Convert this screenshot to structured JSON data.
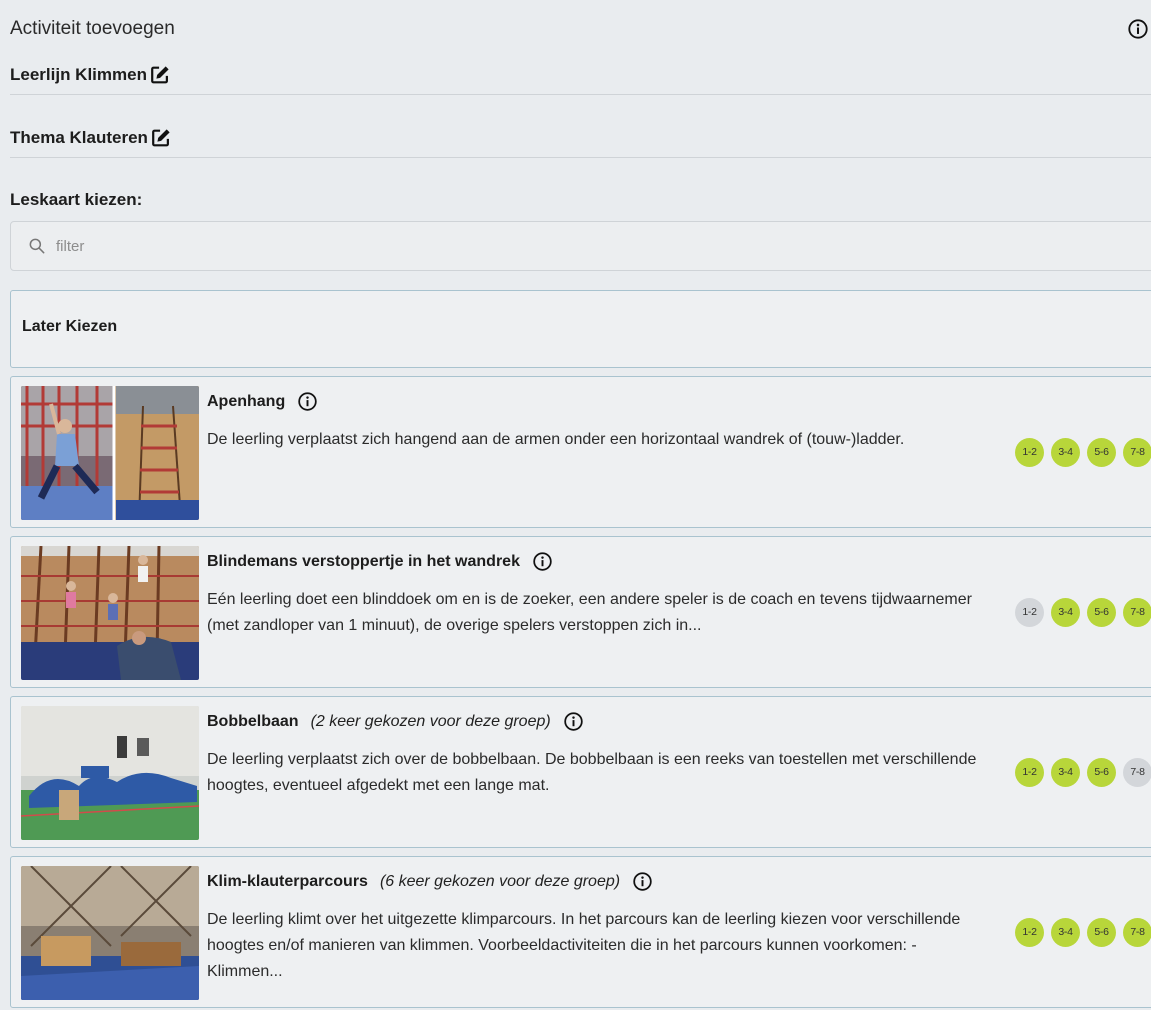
{
  "header": {
    "title": "Activiteit toevoegen"
  },
  "fields": {
    "leerlijn": "Leerlijn Klimmen",
    "thema": "Thema Klauteren"
  },
  "leskaart": {
    "label": "Leskaart kiezen:",
    "filter_placeholder": "filter",
    "later_option": "Later Kiezen"
  },
  "colors": {
    "badge_active": "#b8d63a",
    "badge_inactive": "#d3d6da",
    "card_border": "#a9c3cf"
  },
  "activities": [
    {
      "name": "Apenhang",
      "note": "",
      "description": "De leerling verplaatst zich hangend aan de armen onder een horizontaal wandrek of (touw-)ladder.",
      "groups": [
        {
          "label": "1-2",
          "active": true
        },
        {
          "label": "3-4",
          "active": true
        },
        {
          "label": "5-6",
          "active": true
        },
        {
          "label": "7-8",
          "active": true
        }
      ]
    },
    {
      "name": "Blindemans verstoppertje in het wandrek",
      "note": "",
      "description": "Eén leerling doet een blinddoek om en is de zoeker, een andere speler is de coach en tevens tijdwaarnemer (met zandloper van 1 minuut), de overige spelers verstoppen zich in...",
      "groups": [
        {
          "label": "1-2",
          "active": false
        },
        {
          "label": "3-4",
          "active": true
        },
        {
          "label": "5-6",
          "active": true
        },
        {
          "label": "7-8",
          "active": true
        }
      ]
    },
    {
      "name": "Bobbelbaan",
      "note": "(2 keer gekozen voor deze groep)",
      "description": "De leerling verplaatst zich over de bobbelbaan. De bobbelbaan is een reeks van toestellen met verschillende hoogtes, eventueel afgedekt met een lange mat.",
      "groups": [
        {
          "label": "1-2",
          "active": true
        },
        {
          "label": "3-4",
          "active": true
        },
        {
          "label": "5-6",
          "active": true
        },
        {
          "label": "7-8",
          "active": false
        }
      ]
    },
    {
      "name": "Klim-klauterparcours",
      "note": "(6 keer gekozen voor deze groep)",
      "description": "De leerling klimt over het uitgezette klimparcours. In het parcours kan de leerling kiezen voor verschillende hoogtes en/of manieren van klimmen. Voorbeeldactiviteiten die in het parcours kunnen voorkomen: - Klimmen...",
      "groups": [
        {
          "label": "1-2",
          "active": true
        },
        {
          "label": "3-4",
          "active": true
        },
        {
          "label": "5-6",
          "active": true
        },
        {
          "label": "7-8",
          "active": true
        }
      ]
    }
  ]
}
